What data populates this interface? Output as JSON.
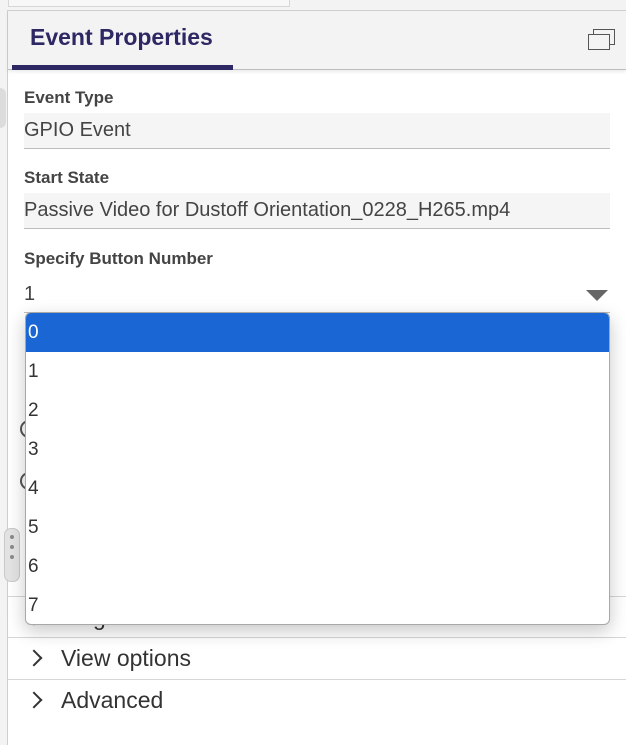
{
  "header": {
    "title": "Event Properties"
  },
  "fields": [
    {
      "label": "Event Type",
      "value": "GPIO Event"
    },
    {
      "label": "Start State",
      "value": "Passive Video for Dustoff Orientation_0228_H265.mp4"
    }
  ],
  "button_select": {
    "label": "Specify Button Number",
    "value": "1",
    "options": [
      "0",
      "1",
      "2",
      "3",
      "4",
      "5",
      "6",
      "7"
    ],
    "highlighted": "0"
  },
  "sections": [
    {
      "label": "Target State"
    },
    {
      "label": "View options"
    },
    {
      "label": "Advanced"
    }
  ],
  "colors": {
    "accent": "#2d2763",
    "highlight": "#1a66d4"
  }
}
